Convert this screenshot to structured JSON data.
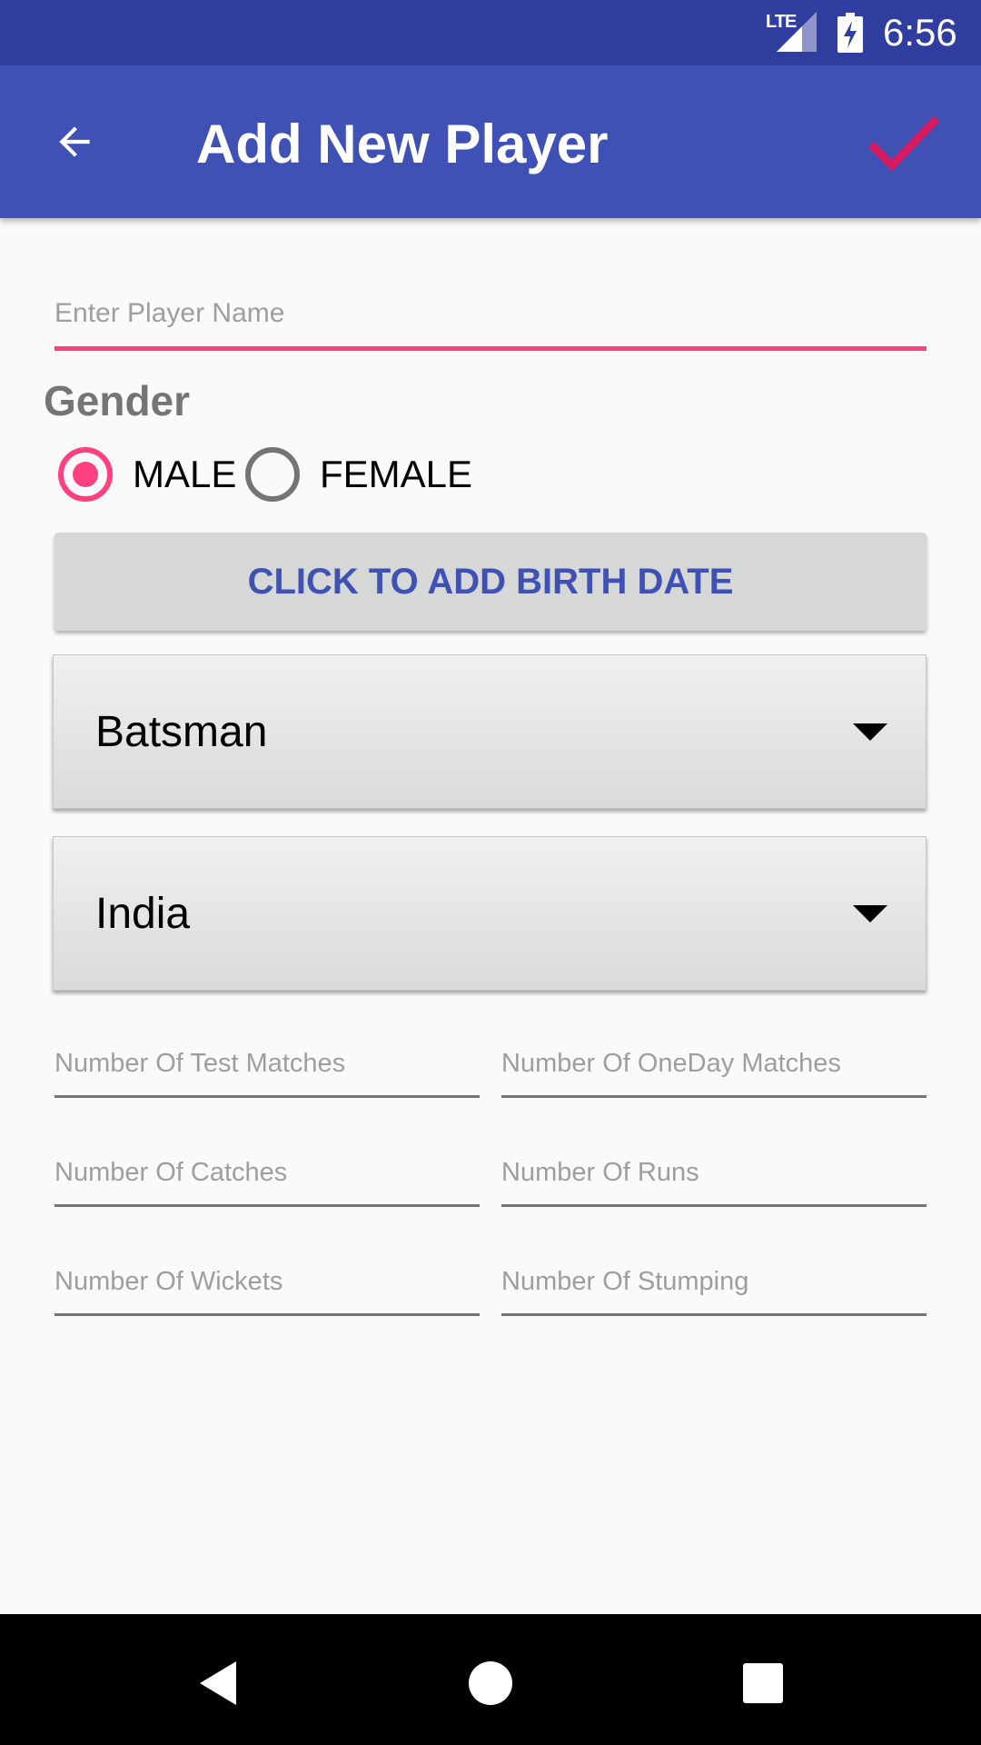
{
  "status_bar": {
    "network": "LTE",
    "time": "6:56",
    "icons": [
      "signal-icon",
      "battery-charging-icon"
    ]
  },
  "app_bar": {
    "title": "Add New Player",
    "back_icon": "arrow-back-icon",
    "save_icon": "check-icon",
    "save_icon_color": "#d81b60",
    "background": "#3f51b5"
  },
  "form": {
    "name_placeholder": "Enter Player Name",
    "name_value": "",
    "gender_label": "Gender",
    "gender_options": [
      "MALE",
      "FEMALE"
    ],
    "gender_selected": "MALE",
    "birth_date_button": "CLICK TO ADD BIRTH DATE",
    "role_selected": "Batsman",
    "country_selected": "India",
    "stats_fields": {
      "test_matches": "Number Of Test Matches",
      "oneday_matches": "Number Of OneDay Matches",
      "catches": "Number Of Catches",
      "runs": "Number Of Runs",
      "wickets": "Number Of Wickets",
      "stumping": "Number Of Stumping"
    }
  },
  "colors": {
    "primary": "#3f51b5",
    "primary_dark": "#303f9f",
    "accent": "#ff4081"
  },
  "nav_bar": {
    "icons": [
      "nav-back-icon",
      "nav-home-icon",
      "nav-recents-icon"
    ]
  }
}
